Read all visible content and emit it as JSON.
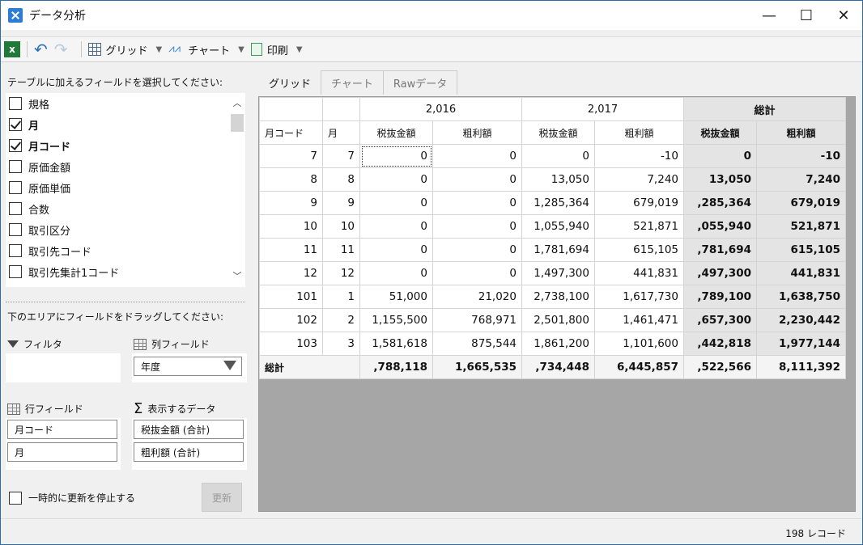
{
  "window": {
    "title": "データ分析",
    "minimize": "—",
    "maximize": "☐",
    "close": "✕"
  },
  "toolbar": {
    "excel": "x",
    "grid_label": "グリッド",
    "chart_label": "チャート",
    "print_label": "印刷"
  },
  "left": {
    "select_heading": "テーブルに加えるフィールドを選択してください:",
    "fields": [
      {
        "label": "規格",
        "checked": false
      },
      {
        "label": "月",
        "checked": true
      },
      {
        "label": "月コード",
        "checked": true
      },
      {
        "label": "原価金額",
        "checked": false
      },
      {
        "label": "原価単価",
        "checked": false
      },
      {
        "label": "合数",
        "checked": false
      },
      {
        "label": "取引区分",
        "checked": false
      },
      {
        "label": "取引先コード",
        "checked": false
      },
      {
        "label": "取引先集計1コード",
        "checked": false
      }
    ],
    "drag_heading": "下のエリアにフィールドをドラッグしてください:",
    "filter_label": "フィルタ",
    "column_label": "列フィールド",
    "column_chip": "年度",
    "row_label": "行フィールド",
    "row_chips": [
      "月コード",
      "月"
    ],
    "data_label": "表示するデータ",
    "data_chips": [
      "税抜金額 (合計)",
      "粗利額 (合計)"
    ],
    "pause_label": "一時的に更新を停止する",
    "update_btn": "更新"
  },
  "tabs": [
    "グリッド",
    "チャート",
    "Rawデータ"
  ],
  "grid": {
    "year_headers": [
      "2,016",
      "2,017",
      "総計"
    ],
    "col_headers": [
      "月コード",
      "月",
      "税抜金額",
      "粗利額",
      "税抜金額",
      "粗利額",
      "税抜金額",
      "粗利額"
    ],
    "rows": [
      [
        "7",
        "7",
        "0",
        "0",
        "0",
        "-10",
        "0",
        "-10"
      ],
      [
        "8",
        "8",
        "0",
        "0",
        "13,050",
        "7,240",
        "13,050",
        "7,240"
      ],
      [
        "9",
        "9",
        "0",
        "0",
        "1,285,364",
        "679,019",
        ",285,364",
        "679,019"
      ],
      [
        "10",
        "10",
        "0",
        "0",
        "1,055,940",
        "521,871",
        ",055,940",
        "521,871"
      ],
      [
        "11",
        "11",
        "0",
        "0",
        "1,781,694",
        "615,105",
        ",781,694",
        "615,105"
      ],
      [
        "12",
        "12",
        "0",
        "0",
        "1,497,300",
        "441,831",
        ",497,300",
        "441,831"
      ],
      [
        "101",
        "1",
        "51,000",
        "21,020",
        "2,738,100",
        "1,617,730",
        ",789,100",
        "1,638,750"
      ],
      [
        "102",
        "2",
        "1,155,500",
        "768,971",
        "2,501,800",
        "1,461,471",
        ",657,300",
        "2,230,442"
      ],
      [
        "103",
        "3",
        "1,581,618",
        "875,544",
        "1,861,200",
        "1,101,600",
        ",442,818",
        "1,977,144"
      ]
    ],
    "total_label": "総計",
    "total_row": [
      ",788,118",
      "1,665,535",
      ",734,448",
      "6,445,857",
      ",522,566",
      "8,111,392"
    ]
  },
  "status": {
    "records": "198 レコード"
  }
}
